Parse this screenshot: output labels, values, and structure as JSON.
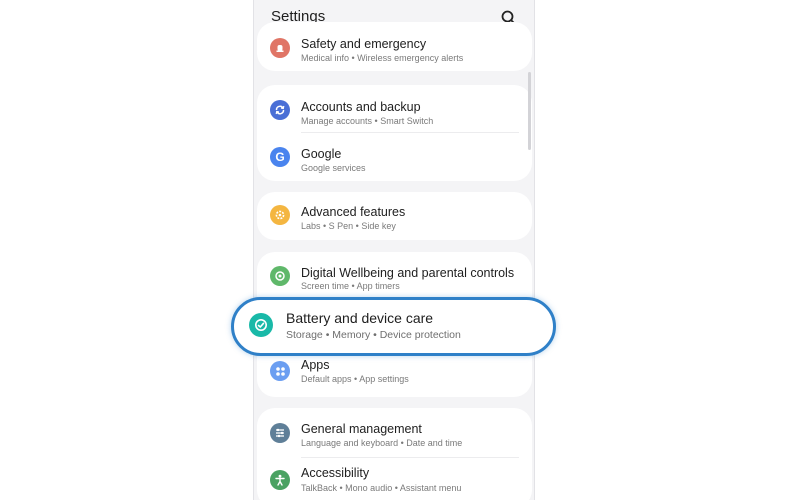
{
  "header": {
    "title": "Settings",
    "search_icon": "search-icon"
  },
  "colors": {
    "safety": "#e07566",
    "accounts": "#4a6fd6",
    "google": "#4a84ee",
    "advanced": "#f4b641",
    "wellbeing": "#5fb86a",
    "battery": "#19b9a8",
    "apps": "#6b9ef1",
    "general": "#5f7f98",
    "accessibility": "#4aa262",
    "highlight_border": "#2f80c8"
  },
  "items": {
    "safety": {
      "title": "Safety and emergency",
      "subtitle": "Medical info  •  Wireless emergency alerts",
      "icon": "siren-icon"
    },
    "accounts": {
      "title": "Accounts and backup",
      "subtitle": "Manage accounts  •  Smart Switch",
      "icon": "sync-icon"
    },
    "google": {
      "title": "Google",
      "subtitle": "Google services",
      "icon": "google-icon"
    },
    "advanced": {
      "title": "Advanced features",
      "subtitle": "Labs  •  S Pen  •  Side key",
      "icon": "gear-plus-icon"
    },
    "wellbeing": {
      "title": "Digital Wellbeing and parental controls",
      "subtitle": "Screen time  •  App timers",
      "icon": "wellbeing-icon"
    },
    "battery": {
      "title": "Battery and device care",
      "subtitle": "Storage  •  Memory  •  Device protection",
      "icon": "device-care-icon"
    },
    "apps": {
      "title": "Apps",
      "subtitle": "Default apps  •  App settings",
      "icon": "apps-grid-icon"
    },
    "general": {
      "title": "General management",
      "subtitle": "Language and keyboard  •  Date and time",
      "icon": "sliders-icon"
    },
    "accessibility": {
      "title": "Accessibility",
      "subtitle": "TalkBack  •  Mono audio  •  Assistant menu",
      "icon": "accessibility-icon"
    }
  }
}
